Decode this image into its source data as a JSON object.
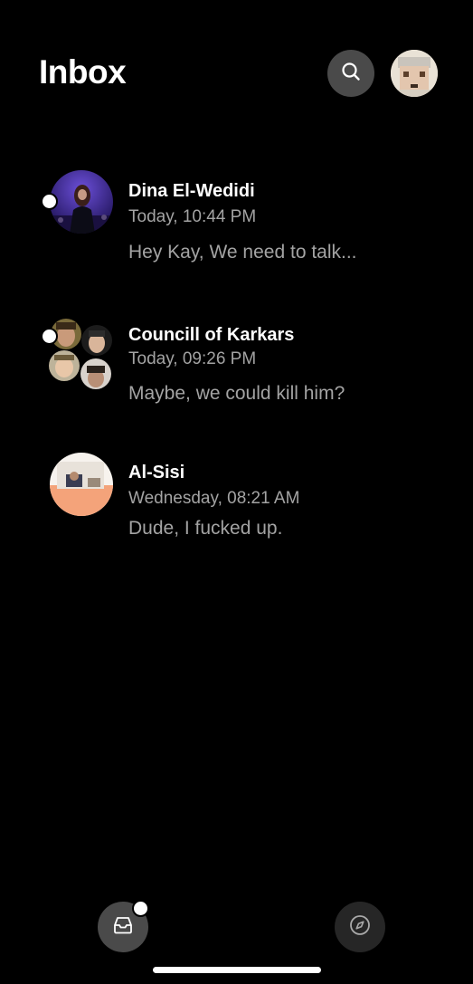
{
  "header": {
    "title": "Inbox"
  },
  "conversations": [
    {
      "name": "Dina El-Wedidi",
      "time": "Today, 10:44 PM",
      "preview": "Hey Kay, We need to talk...",
      "unread": true
    },
    {
      "name": "Councill of Karkars",
      "time": "Today, 09:26 PM",
      "preview": "Maybe, we could kill him?",
      "unread": true
    },
    {
      "name": "Al-Sisi",
      "time": "Wednesday, 08:21 AM",
      "preview": "Dude, I fucked up.",
      "unread": false
    }
  ],
  "icons": {
    "search": "search-icon",
    "inbox": "inbox-tray-icon",
    "explore": "compass-icon"
  },
  "colors": {
    "background": "#000000",
    "primary_text": "#ffffff",
    "secondary_text": "#a3a3a3",
    "button_bg": "#4a4a4a",
    "nav_inactive_bg": "#262626"
  }
}
